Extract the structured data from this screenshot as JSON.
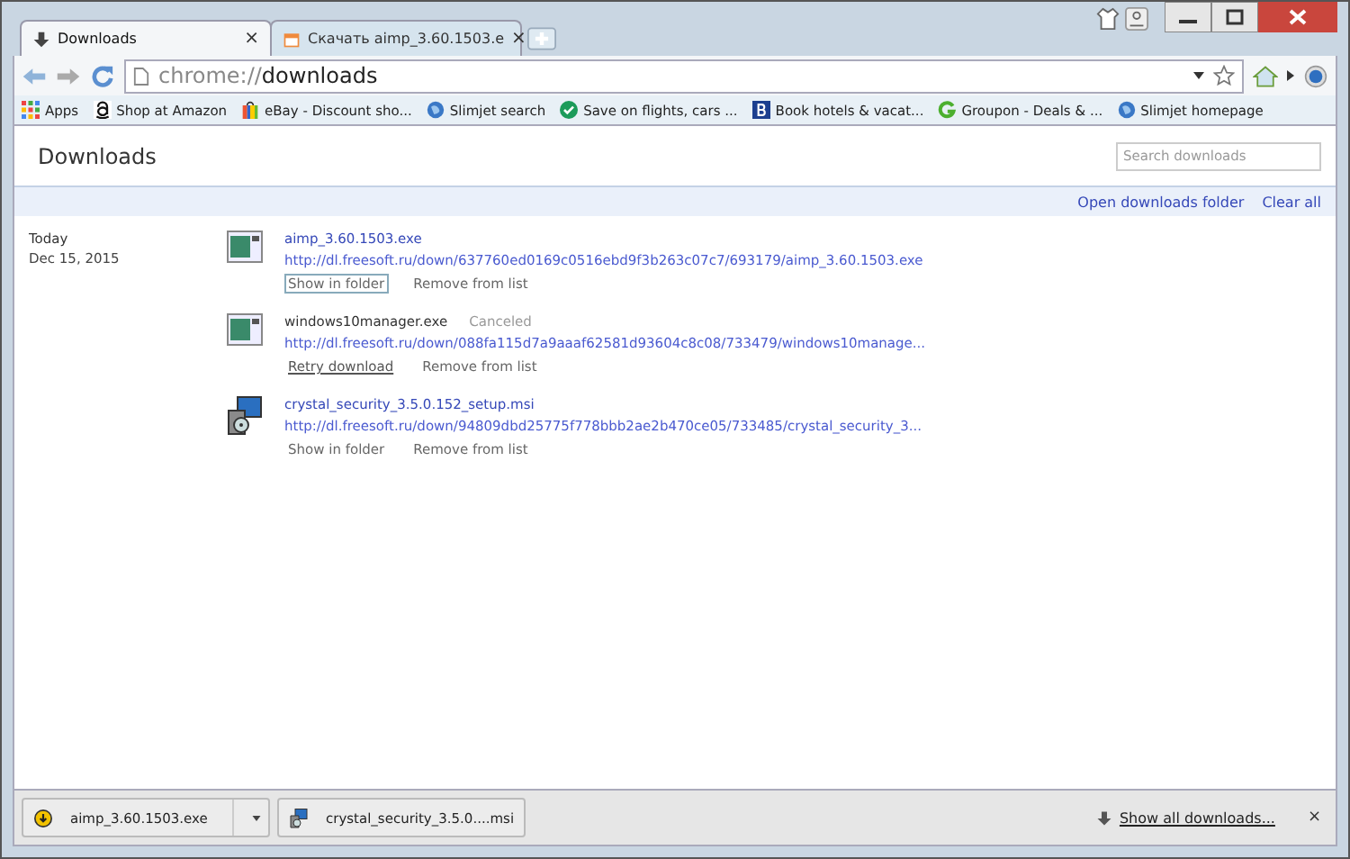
{
  "tabs": [
    {
      "title": "Downloads",
      "close": "×",
      "selected": true,
      "kind": "download"
    },
    {
      "title": "Скачать aimp_3.60.1503.e",
      "close": "×",
      "selected": false,
      "kind": "page"
    }
  ],
  "address": {
    "scheme": "chrome://",
    "path": "downloads"
  },
  "bookmarks": [
    {
      "label": "Apps",
      "kind": "apps"
    },
    {
      "label": "Shop at Amazon",
      "kind": "amazon"
    },
    {
      "label": "eBay - Discount sho...",
      "kind": "bag"
    },
    {
      "label": "Slimjet search",
      "kind": "globe"
    },
    {
      "label": "Save on flights, cars ...",
      "kind": "check"
    },
    {
      "label": "Book hotels & vacat...",
      "kind": "b"
    },
    {
      "label": "Groupon - Deals & ...",
      "kind": "g"
    },
    {
      "label": "Slimjet homepage",
      "kind": "globe"
    }
  ],
  "page": {
    "title": "Downloads",
    "search": {
      "placeholder": "Search downloads"
    },
    "links": [
      "Open downloads folder",
      "Clear all"
    ],
    "group": {
      "day": "Today",
      "date": "Dec 15, 2015"
    },
    "items": [
      {
        "name": "aimp_3.60.1503.exe",
        "canceled": false,
        "kind": "exe",
        "url": "http://dl.freesoft.ru/down/637760ed0169c0516ebd9f3b263c07c7/693179/aimp_3.60.1503.exe",
        "actions": [
          {
            "label": "Show in folder",
            "kind": "show",
            "focused": true
          },
          {
            "label": "Remove from list",
            "kind": "remove",
            "focused": false
          }
        ]
      },
      {
        "name": "windows10manager.exe",
        "status": "Canceled",
        "canceled": true,
        "kind": "exe",
        "url": "http://dl.freesoft.ru/down/088fa115d7a9aaaf62581d93604c8c08/733479/windows10manage...",
        "actions": [
          {
            "label": "Retry download",
            "kind": "retry",
            "focused": false
          },
          {
            "label": "Remove from list",
            "kind": "remove",
            "focused": false
          }
        ]
      },
      {
        "name": "crystal_security_3.5.0.152_setup.msi",
        "canceled": false,
        "kind": "msi",
        "url": "http://dl.freesoft.ru/down/94809dbd25775f778bbb2ae2b470ce05/733485/crystal_security_3...",
        "actions": [
          {
            "label": "Show in folder",
            "kind": "show",
            "focused": false
          },
          {
            "label": "Remove from list",
            "kind": "remove",
            "focused": false
          }
        ]
      }
    ]
  },
  "shelf": {
    "items": [
      {
        "name": "aimp_3.60.1503.exe",
        "kind": "warning"
      },
      {
        "name": "crystal_security_3.5.0....msi",
        "kind": "msi"
      }
    ],
    "show_all": "Show all downloads...",
    "close": "×"
  }
}
